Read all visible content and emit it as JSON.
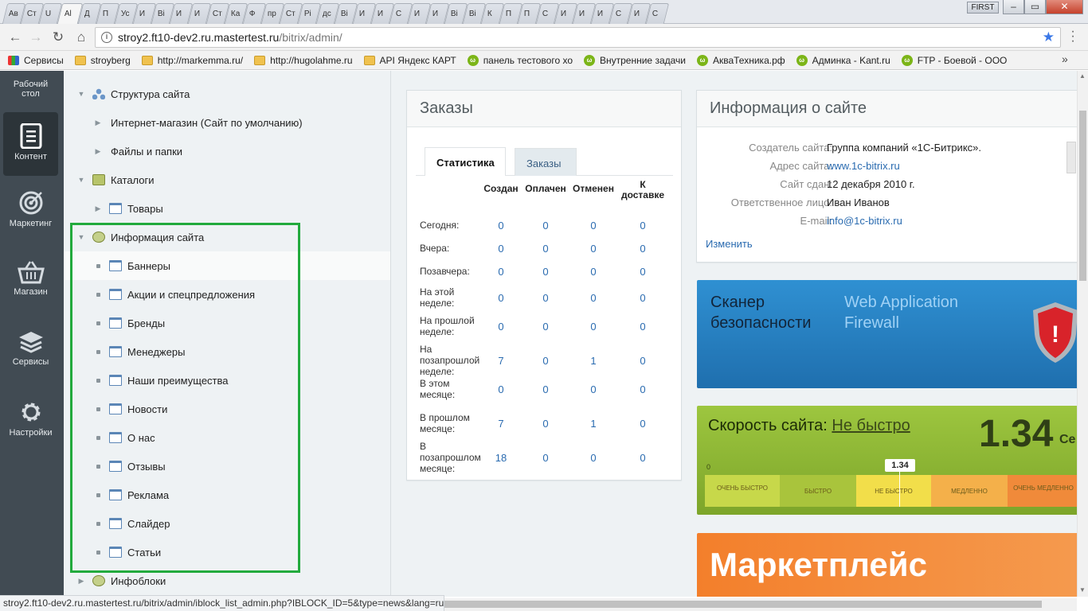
{
  "browser": {
    "tabs": [
      "Ав",
      "Ст",
      "U",
      "Al",
      "Д",
      "П",
      "Ус",
      "И",
      "Ві",
      "И",
      "И",
      "Ст",
      "Ка",
      "Ф",
      "пр",
      "Ст",
      "Рі",
      "дс",
      "Ві",
      "И",
      "И",
      "С",
      "И",
      "И",
      "Ві",
      "Ві",
      "К",
      "П",
      "П",
      "С",
      "И",
      "И",
      "И",
      "С",
      "И",
      "С"
    ],
    "user_badge": "FIRST",
    "win_min": "–",
    "win_max": "▭",
    "win_close": "✕",
    "url_host": "stroy2.ft10-dev2.ru.mastertest.ru",
    "url_path": "/bitrix/admin/",
    "bookmarks": [
      {
        "label": "Сервисы",
        "icon": "apps-grid-icon"
      },
      {
        "label": "stroyberg",
        "icon": "folder-icon"
      },
      {
        "label": "http://markemma.ru/",
        "icon": "folder-icon"
      },
      {
        "label": "http://hugolahme.ru",
        "icon": "folder-icon"
      },
      {
        "label": "API Яндекс КАРТ",
        "icon": "folder-icon"
      },
      {
        "label": "панель тестового хо",
        "icon": "bitrix-icon"
      },
      {
        "label": "Внутренние задачи",
        "icon": "bitrix-icon"
      },
      {
        "label": "АкваТехника.рф",
        "icon": "bitrix-icon"
      },
      {
        "label": "Админка   - Kant.ru",
        "icon": "bitrix-icon"
      },
      {
        "label": "FTP - Боевой - ООО",
        "icon": "bitrix-icon"
      }
    ],
    "more": "»",
    "status_url": "stroy2.ft10-dev2.ru.mastertest.ru/bitrix/admin/iblock_list_admin.php?IBLOCK_ID=5&type=news&lang=ru"
  },
  "leftpanel": {
    "desktop": "Рабочий стол",
    "items": [
      {
        "label": "Контент",
        "icon": "document-icon",
        "active": true
      },
      {
        "label": "Маркетинг",
        "icon": "target-icon"
      },
      {
        "label": "Магазин",
        "icon": "basket-icon"
      },
      {
        "label": "Сервисы",
        "icon": "layers-icon"
      },
      {
        "label": "Настройки",
        "icon": "gear-icon"
      }
    ]
  },
  "tree": {
    "items": [
      {
        "label": "Структура сайта"
      },
      {
        "label": "Интернет-магазин (Сайт по умолчанию)"
      },
      {
        "label": "Файлы и папки"
      },
      {
        "label": "Каталоги"
      },
      {
        "label": "Товары"
      },
      {
        "label": "Информация сайта"
      },
      {
        "label": "Баннеры"
      },
      {
        "label": "Акции и спецпредложения"
      },
      {
        "label": "Бренды"
      },
      {
        "label": "Менеджеры"
      },
      {
        "label": "Наши преимущества"
      },
      {
        "label": "Новости"
      },
      {
        "label": "О нас"
      },
      {
        "label": "Отзывы"
      },
      {
        "label": "Реклама"
      },
      {
        "label": "Слайдер"
      },
      {
        "label": "Статьи"
      },
      {
        "label": "Инфоблоки"
      }
    ]
  },
  "orders": {
    "title": "Заказы",
    "tabs": [
      "Статистика",
      "Заказы"
    ],
    "columns": [
      "Создан",
      "Оплачен",
      "Отменен",
      "К доставке"
    ],
    "rows": [
      {
        "label": "Сегодня:",
        "values": [
          "0",
          "0",
          "0",
          "0"
        ]
      },
      {
        "label": "Вчера:",
        "values": [
          "0",
          "0",
          "0",
          "0"
        ]
      },
      {
        "label": "Позавчера:",
        "values": [
          "0",
          "0",
          "0",
          "0"
        ]
      },
      {
        "label": "На этой неделе:",
        "values": [
          "0",
          "0",
          "0",
          "0"
        ]
      },
      {
        "label": "На прошлой неделе:",
        "values": [
          "0",
          "0",
          "0",
          "0"
        ]
      },
      {
        "label": "На позапрошлой неделе:",
        "values": [
          "7",
          "0",
          "1",
          "0"
        ]
      },
      {
        "label": "В этом месяце:",
        "values": [
          "0",
          "0",
          "0",
          "0"
        ]
      },
      {
        "label": "В прошлом месяце:",
        "values": [
          "7",
          "0",
          "1",
          "0"
        ]
      },
      {
        "label": "В позапрошлом месяце:",
        "values": [
          "18",
          "0",
          "0",
          "0"
        ]
      }
    ]
  },
  "siteinfo": {
    "title": "Информация о сайте",
    "rows": [
      {
        "key": "Создатель сайта:",
        "value": "Группа компаний «1С-Битрикс»."
      },
      {
        "key": "Адрес сайта:",
        "value": "www.1c-bitrix.ru"
      },
      {
        "key": "Сайт сдан:",
        "value": "12 декабря 2010 г."
      },
      {
        "key": "Ответственное лицо:",
        "value": "Иван Иванов"
      },
      {
        "key": "E-mail:",
        "value": "info@1c-bitrix.ru"
      }
    ],
    "change": "Изменить"
  },
  "scanner": {
    "title": "Сканер безопасности",
    "subtitle": "Web Application Firewall",
    "shield": "!"
  },
  "speed": {
    "title": "Скорость сайта:",
    "status": "Не быстро",
    "value": "1.34",
    "unit": "Се",
    "zero": "0",
    "marker": "1.34",
    "segments": [
      {
        "label": "ОЧЕНЬ БЫСТРО",
        "color": "#c7d84a"
      },
      {
        "label": "БЫСТРО",
        "color": "#a9c43c"
      },
      {
        "label": "НЕ БЫСТРО",
        "color": "#f2de4a"
      },
      {
        "label": "МЕДЛЕННО",
        "color": "#f4b04a"
      },
      {
        "label": "ОЧЕНЬ МЕДЛЕННО",
        "color": "#f08a3a"
      }
    ]
  },
  "market": {
    "title": "Маркетплейс"
  },
  "colors": {
    "accent": "#2a6bb0",
    "frame": "#22aa3d",
    "panel": "#414b53"
  }
}
